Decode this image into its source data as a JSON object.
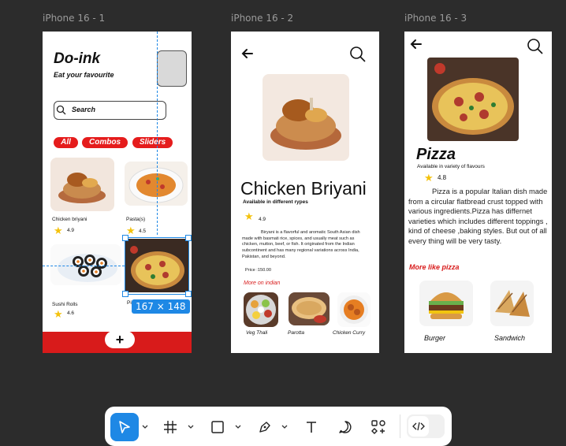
{
  "frames": [
    {
      "label": "iPhone 16 - 1"
    },
    {
      "label": "iPhone 16 - 2"
    },
    {
      "label": "iPhone 16 - 3"
    }
  ],
  "screen1": {
    "title": "Do-ink",
    "subtitle": "Eat your favourite",
    "search_placeholder": "Search",
    "filters": [
      "All",
      "Combos",
      "Sliders"
    ],
    "items": [
      {
        "name": "Chicken briyani",
        "rating": "4.9"
      },
      {
        "name": "Pasta(s)",
        "rating": "4.5"
      },
      {
        "name": "Sushi Rolls",
        "rating": "4.6"
      },
      {
        "name": "Pi"
      }
    ],
    "selection_size": "167 × 148",
    "fab": "+"
  },
  "screen2": {
    "title": "Chicken Briyani",
    "subtitle": "Available in different rypes",
    "rating": "4.9",
    "description": "Biryani is a flavorful and aromatic South Asian dish  made with basmati rice, spices, and usually meat  such as chicken, mutton, beef, or fish. It originated from the Indian subcontinent and has many regional variations across India, Pakistan, and beyond.",
    "price": "Price :150.00",
    "more_label": "More on indian",
    "more_items": [
      "Veg Thali",
      "Parotta",
      "Chicken Curry"
    ]
  },
  "screen3": {
    "title": "Pizza",
    "subtitle": "Available in variety of flavours",
    "rating": "4.8",
    "description": "Pizza is a popular Italian dish made from a circular flatbread crust topped with various ingredients.Pizza has differnet varieties which includes different toppings , kind of cheese ,baking styles. But out of all every thing will be very tasty.",
    "more_label": "More like  pizza",
    "more_items": [
      "Burger",
      "Sandwich"
    ]
  },
  "colors": {
    "accent": "#e51c1c",
    "canvas": "#2c2c2c",
    "selection": "#1e88e5",
    "star": "#f4c20d"
  },
  "toolbar": {
    "tools": [
      "move-tool-icon",
      "frame-tool-icon",
      "rectangle-tool-icon",
      "pen-tool-icon",
      "text-tool-icon",
      "comment-tool-icon",
      "components-icon",
      "dev-mode-icon"
    ]
  }
}
